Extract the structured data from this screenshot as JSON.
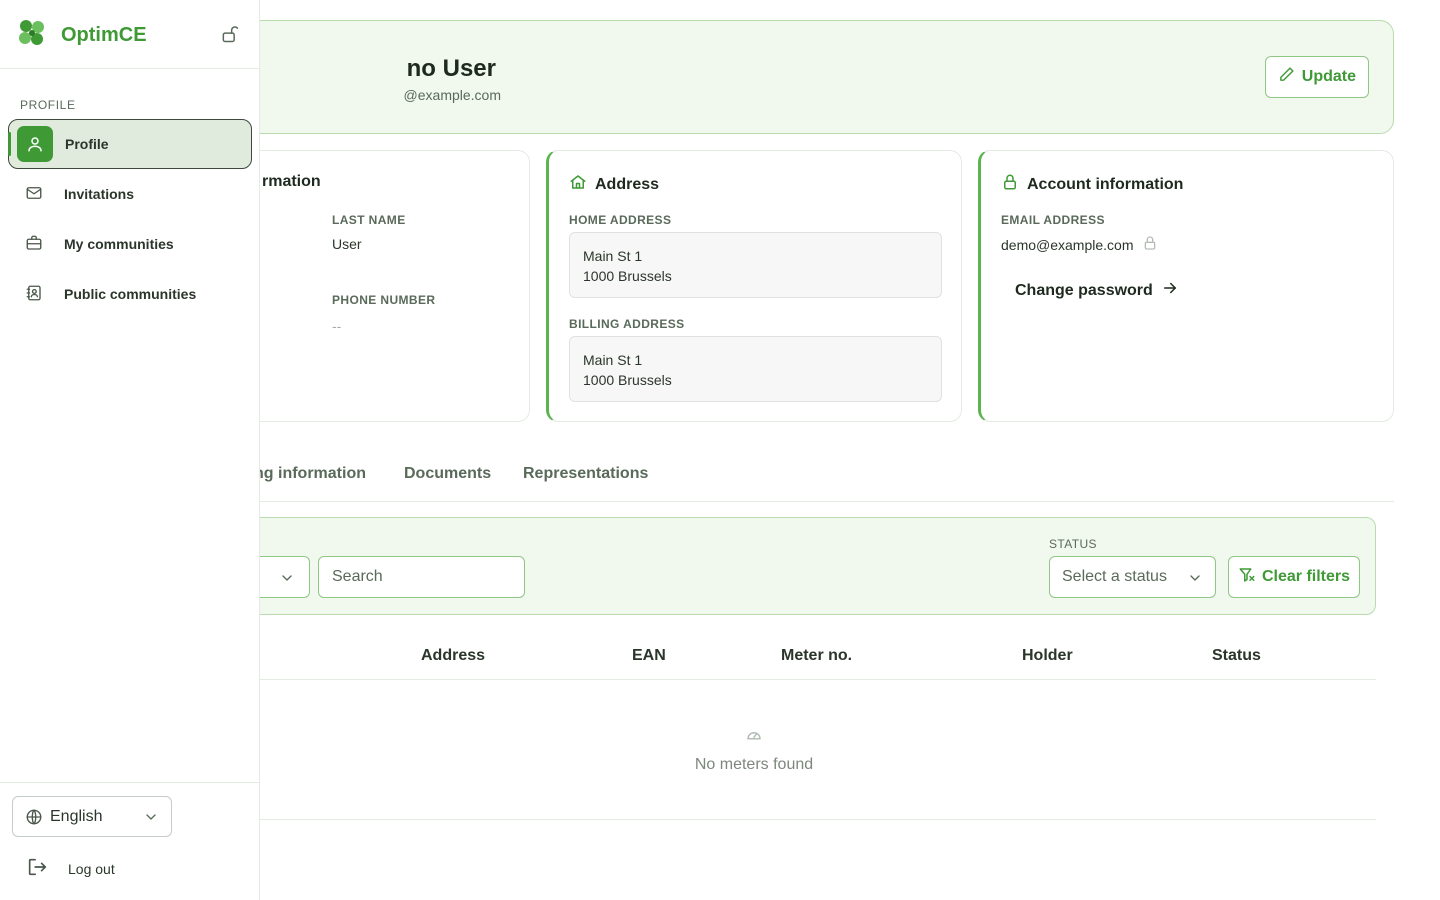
{
  "sidebar": {
    "brand": "OptimCE",
    "section_label": "PROFILE",
    "items": [
      {
        "label": "Profile"
      },
      {
        "label": "Invitations"
      },
      {
        "label": "My communities"
      },
      {
        "label": "Public communities"
      }
    ],
    "language": "English",
    "logout_label": "Log out"
  },
  "hero": {
    "name_visible": "no User",
    "email_visible": "@example.com",
    "update_label": "Update"
  },
  "personal": {
    "title_visible": "rmation",
    "first_name_label_visible": "",
    "last_name_label": "LAST NAME",
    "last_name_value": "User",
    "phone_label": "PHONE NUMBER",
    "phone_value": "--"
  },
  "address": {
    "title": "Address",
    "home_label": "HOME ADDRESS",
    "home_line1": "Main St 1",
    "home_line2": "1000 Brussels",
    "billing_label": "BILLING ADDRESS",
    "billing_line1": "Main St 1",
    "billing_line2": "1000 Brussels"
  },
  "account": {
    "title": "Account information",
    "email_label": "EMAIL ADDRESS",
    "email_value": "demo@example.com",
    "change_password": "Change password"
  },
  "tabs": [
    {
      "label": "ng information"
    },
    {
      "label": "Documents"
    },
    {
      "label": "Representations"
    }
  ],
  "filters": {
    "search_placeholder": "Search",
    "status_label": "STATUS",
    "status_placeholder": "Select a status",
    "clear_label": "Clear filters"
  },
  "table": {
    "columns": [
      "Address",
      "EAN",
      "Meter no.",
      "Holder",
      "Status"
    ],
    "empty_text": "No meters found"
  },
  "colors": {
    "accent": "#3f9a36",
    "accent_light": "#f1f8ee",
    "active_nav_bg": "#e1ebdd"
  }
}
